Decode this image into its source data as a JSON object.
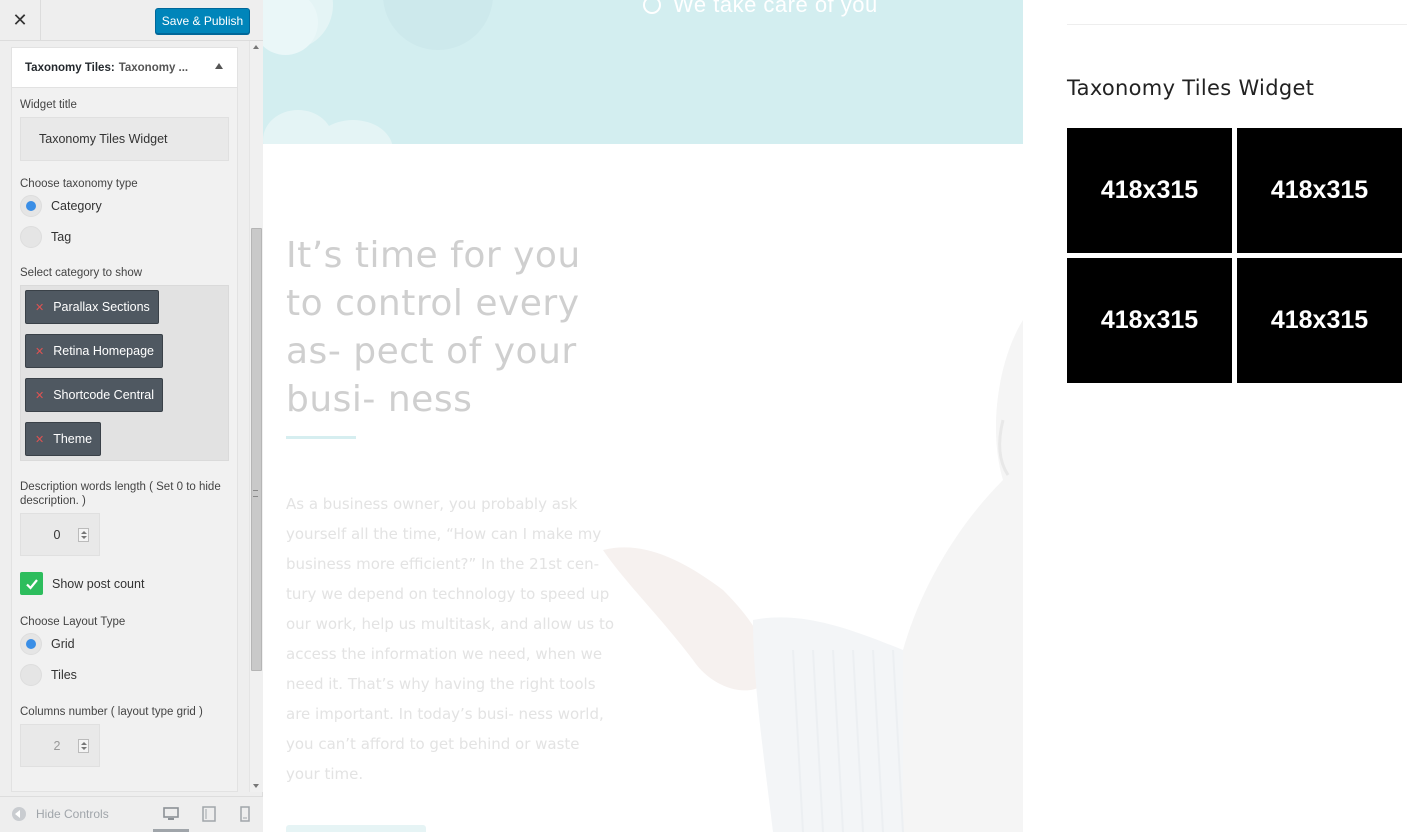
{
  "topbar": {
    "close_glyph": "✕",
    "save_label": "Save & Publish"
  },
  "widget": {
    "title": "Taxonomy Tiles:",
    "title_sub": "Taxonomy ...",
    "widget_title_label": "Widget title",
    "widget_title_value": "Taxonomy Tiles Widget",
    "taxonomy_type_label": "Choose taxonomy type",
    "taxonomy_options": [
      "Category",
      "Tag"
    ],
    "category_label": "Select category to show",
    "categories": [
      "Parallax Sections",
      "Retina Homepage",
      "Shortcode Central",
      "Theme"
    ],
    "desc_length_label": "Description words length ( Set 0 to hide description. )",
    "desc_length_value": "0",
    "post_count_label": "Show post count",
    "layout_label": "Choose Layout Type",
    "layout_options": [
      "Grid",
      "Tiles"
    ],
    "columns_label": "Columns number ( layout type grid )",
    "columns_value": "2"
  },
  "footer": {
    "hide_controls": "Hide Controls"
  },
  "preview": {
    "hero_text": "We take care of you",
    "headline": "It’s time for you to control every as- pect of your busi- ness",
    "paragraph": "As a business owner, you probably ask yourself all the time, “How can I make my business more efficient?” In the 21st cen- tury we depend on technology to speed up our work, help us multitask, and allow us to access the information we need, when we need it. That’s why having the right tools are important. In today’s busi- ness world, you can’t afford to get behind or waste your time.",
    "widget_heading": "Taxonomy Tiles Widget",
    "tiles": [
      "418x315",
      "418x315",
      "418x315",
      "418x315"
    ]
  },
  "colors": {
    "accent": "#0085ba",
    "chip_bg": "#4f5861",
    "check": "#2dbd5d",
    "hero": "#d3eef0"
  }
}
